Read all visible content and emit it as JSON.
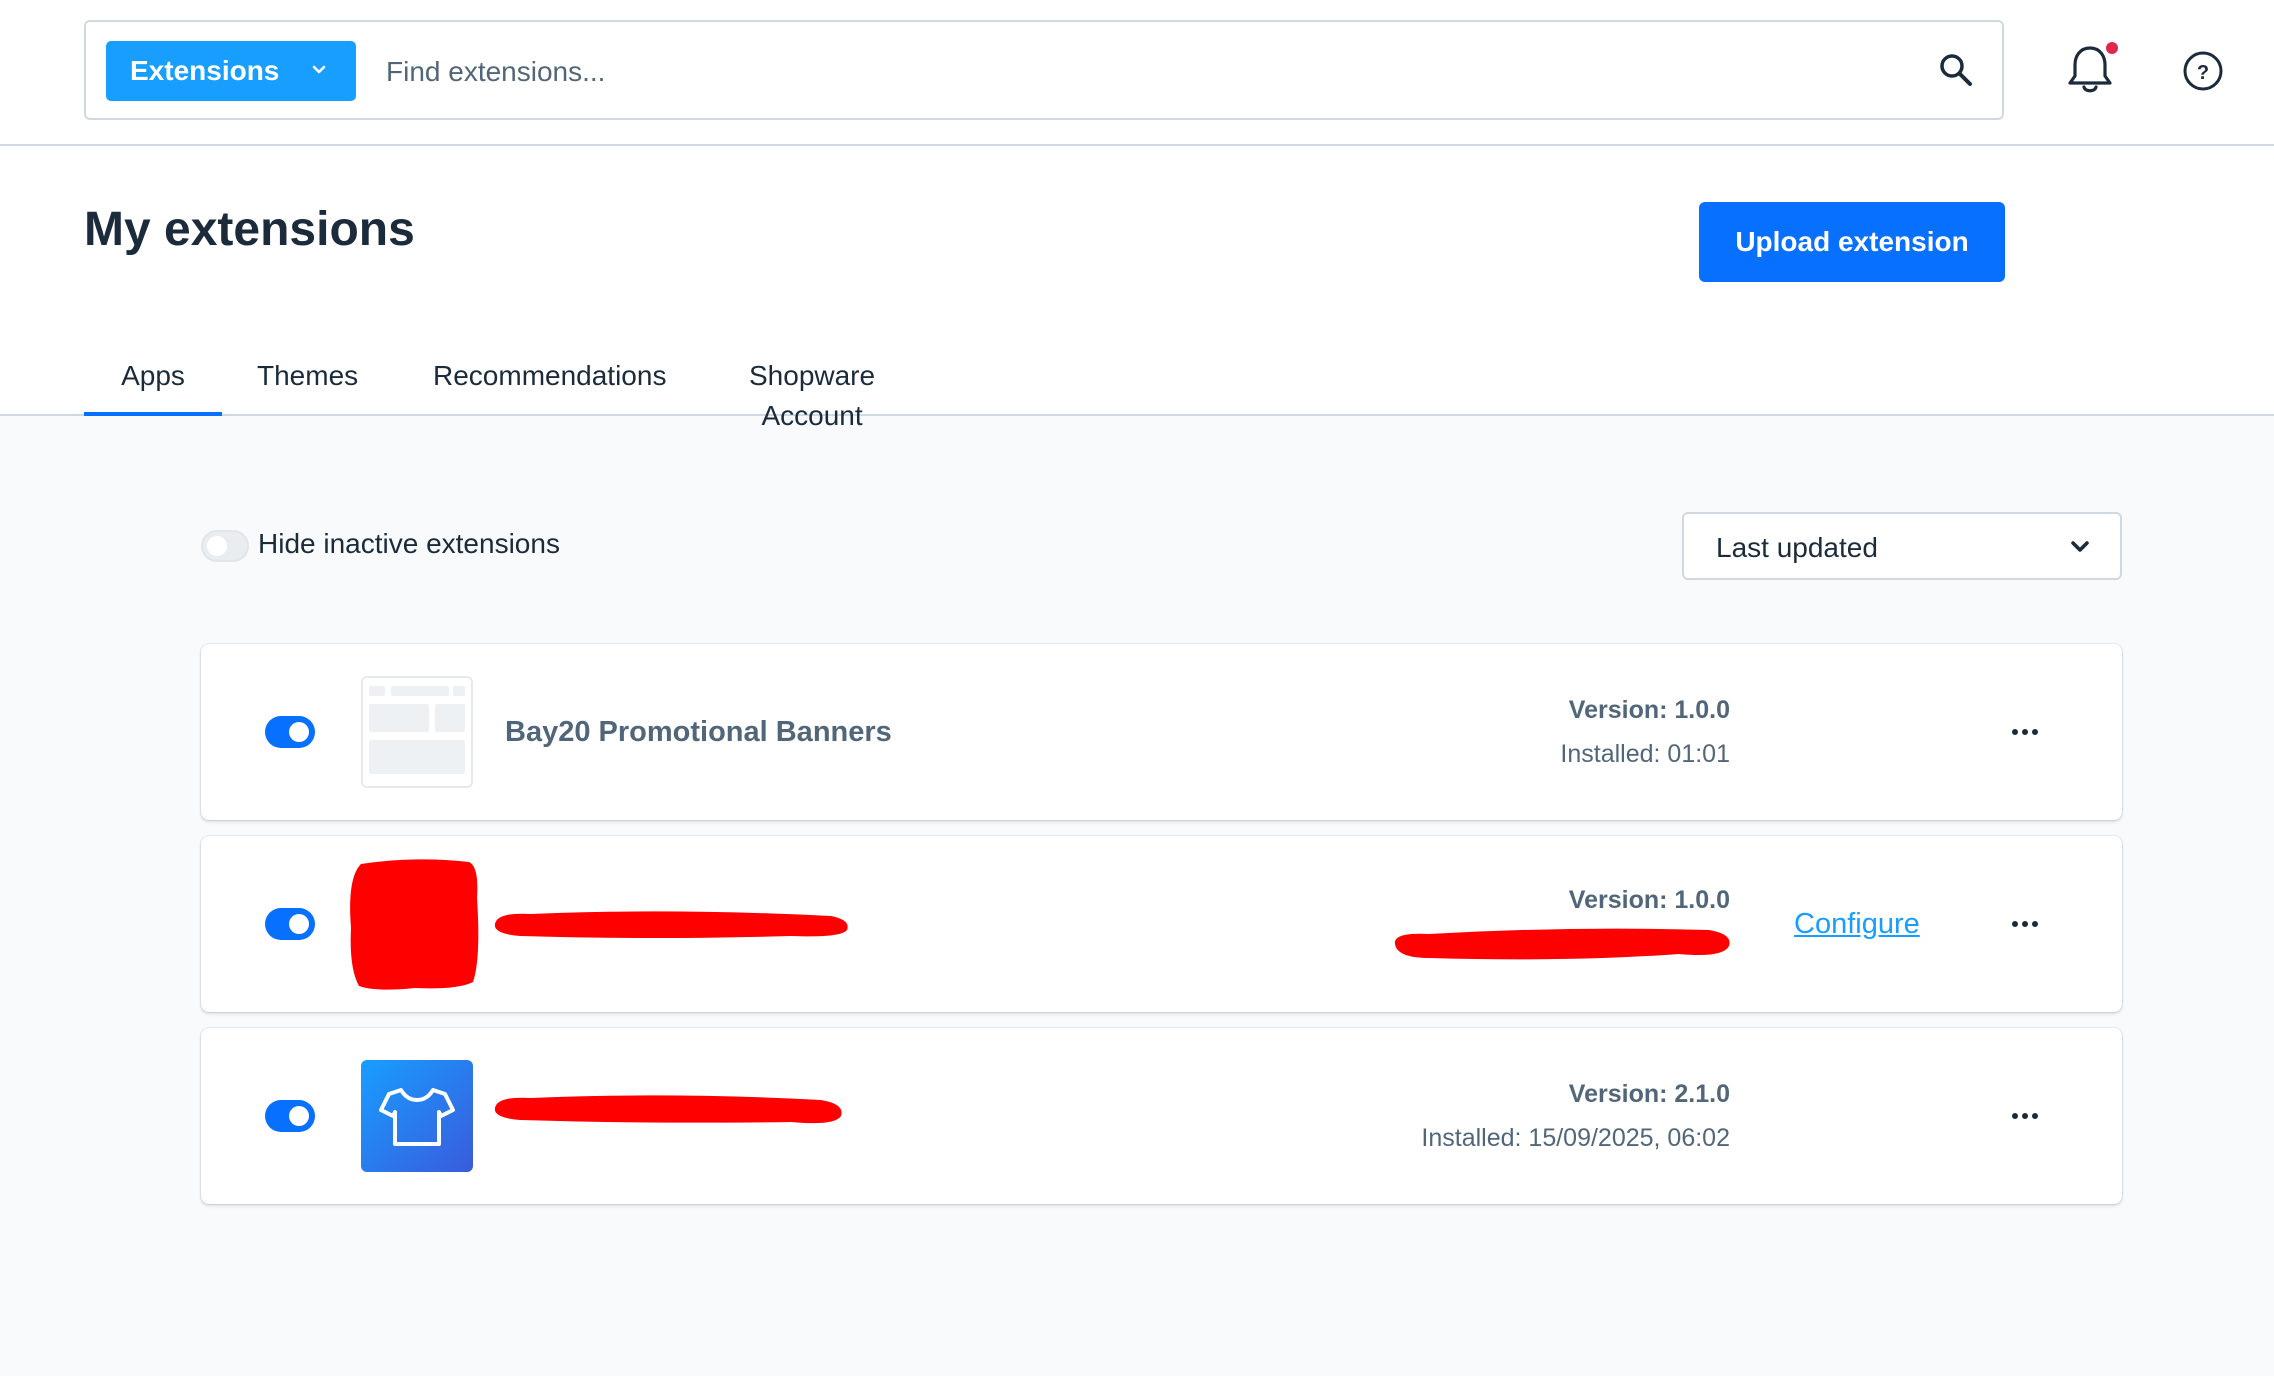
{
  "topbar": {
    "search_type_label": "Extensions",
    "search_placeholder": "Find extensions..."
  },
  "page": {
    "title": "My extensions",
    "upload_label": "Upload extension"
  },
  "tabs": [
    {
      "label": "Apps",
      "active": true
    },
    {
      "label": "Themes",
      "active": false
    },
    {
      "label": "Recommendations",
      "active": false
    },
    {
      "label": "Shopware Account",
      "active": false
    }
  ],
  "filters": {
    "hide_inactive_label": "Hide inactive extensions",
    "hide_inactive_on": false,
    "sort_value": "Last updated"
  },
  "extensions": [
    {
      "name": "Bay20 Promotional Banners",
      "version": "Version: 1.0.0",
      "installed": "Installed: 01:01",
      "active": true,
      "icon": "placeholder-icon"
    },
    {
      "name": "",
      "version": "Version: 1.0.0",
      "installed": "",
      "configure_label": "Configure",
      "active": true,
      "icon": "redacted-icon"
    },
    {
      "name": "",
      "version": "Version: 2.1.0",
      "installed": "Installed: 15/09/2025, 06:02",
      "active": true,
      "icon": "tshirt-icon"
    }
  ],
  "colors": {
    "accent": "#0870ff",
    "search_type": "#189eff",
    "notification_dot": "#de294c",
    "redaction": "#ff0000"
  }
}
